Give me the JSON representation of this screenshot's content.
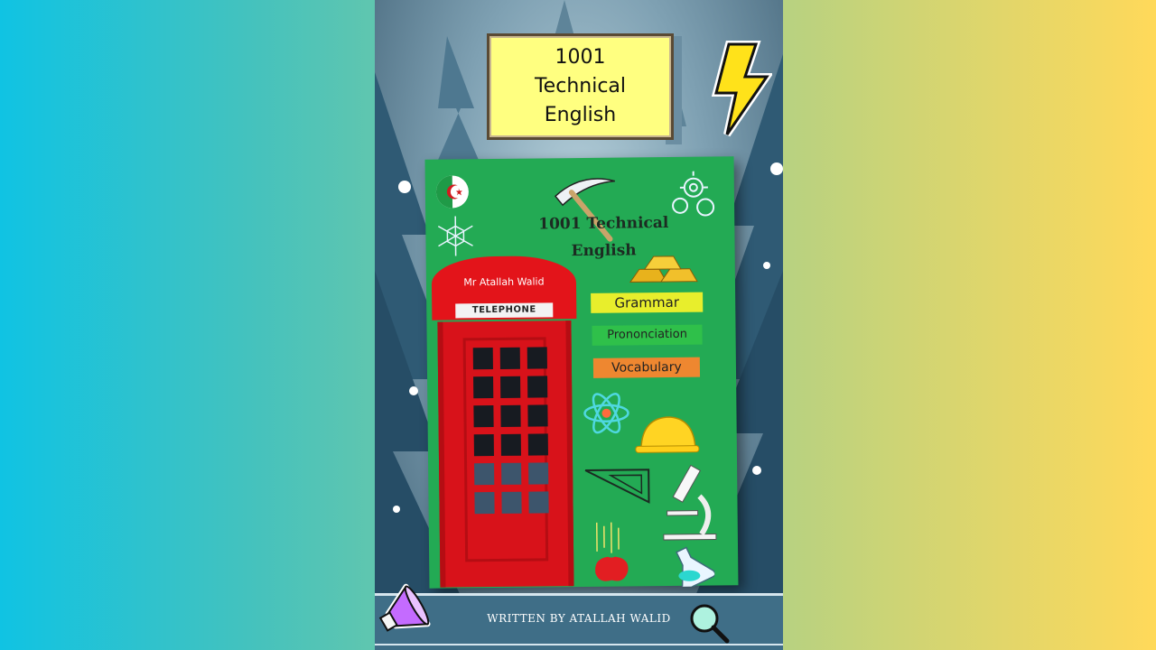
{
  "poster": {
    "title_lines": [
      "1001",
      "Technical",
      "English"
    ],
    "footer_text": "WRITTEN BY ATALLAH WALID"
  },
  "book": {
    "title_lines": [
      "1001 Technical",
      "English"
    ],
    "author": "Mr Atallah Walid",
    "booth_label": "TELEPHONE",
    "tags": {
      "grammar": "Grammar",
      "pronunciation": "Prononciation",
      "vocabulary": "Vocabulary"
    }
  },
  "colors": {
    "background_left": "#10c3e3",
    "background_right": "#ffd95a",
    "title_box": "#ffff80",
    "book_cover": "#23aa54",
    "phone_booth": "#e3141a",
    "footer": "#3f6e87"
  },
  "icons": [
    "lightning-icon",
    "flag-icon",
    "pickaxe-icon",
    "gears-icon",
    "snowflake-icon",
    "gold-bars-icon",
    "atom-icon",
    "hard-hat-icon",
    "set-square-icon",
    "microscope-icon",
    "flask-icon",
    "apple-icon",
    "megaphone-icon",
    "magnifier-icon"
  ]
}
